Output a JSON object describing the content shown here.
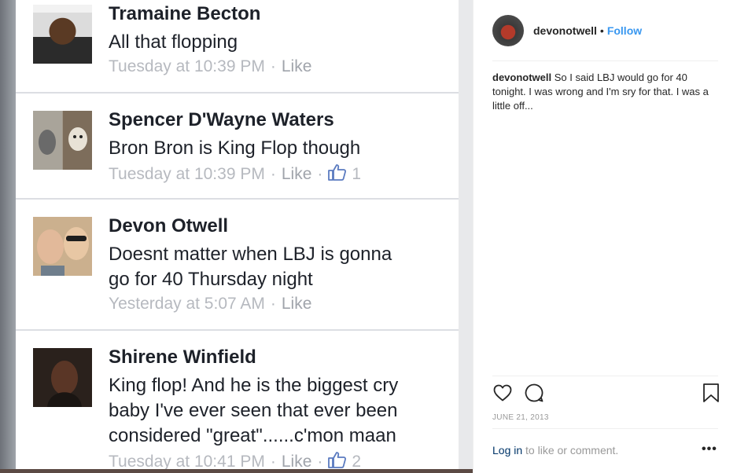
{
  "comments": [
    {
      "name": "Tramaine Becton",
      "text": [
        "All that flopping"
      ],
      "time": "Tuesday at 10:39 PM",
      "like": "Like",
      "likes": ""
    },
    {
      "name": "Spencer D'Wayne Waters",
      "text": [
        "Bron Bron is King Flop though"
      ],
      "time": "Tuesday at 10:39 PM",
      "like": "Like",
      "likes": "1"
    },
    {
      "name": "Devon Otwell",
      "text": [
        "Doesnt matter when LBJ is gonna",
        "go for 40 Thursday night"
      ],
      "time": "Yesterday at 5:07 AM",
      "like": "Like",
      "likes": ""
    },
    {
      "name": "Shirene Winfield",
      "text": [
        "King flop! And he is the biggest cry",
        "baby I've ever seen that ever been",
        "considered \"great\"......c'mon maan"
      ],
      "time": "Tuesday at 10:41 PM",
      "like": "Like",
      "likes": "2"
    }
  ],
  "post": {
    "username": "devonotwell",
    "dot": "•",
    "follow_label": "Follow",
    "caption_user": "devonotwell",
    "caption_text": "So I said LBJ would go for 40 tonight. I was wrong and I'm sry for that. I was a little off...",
    "date": "JUNE 21, 2013",
    "login_link": "Log in",
    "login_text": " to like or comment.",
    "more_label": "•••"
  },
  "icons": {
    "like": "heart-icon",
    "comment": "comment-icon",
    "save": "bookmark-icon",
    "fb_like": "thumbs-up-icon"
  },
  "colors": {
    "follow": "#3897f0",
    "fb_name": "#1d2129",
    "fb_meta": "#b6b9bf",
    "fb_thumb": "#5b7bc0"
  }
}
